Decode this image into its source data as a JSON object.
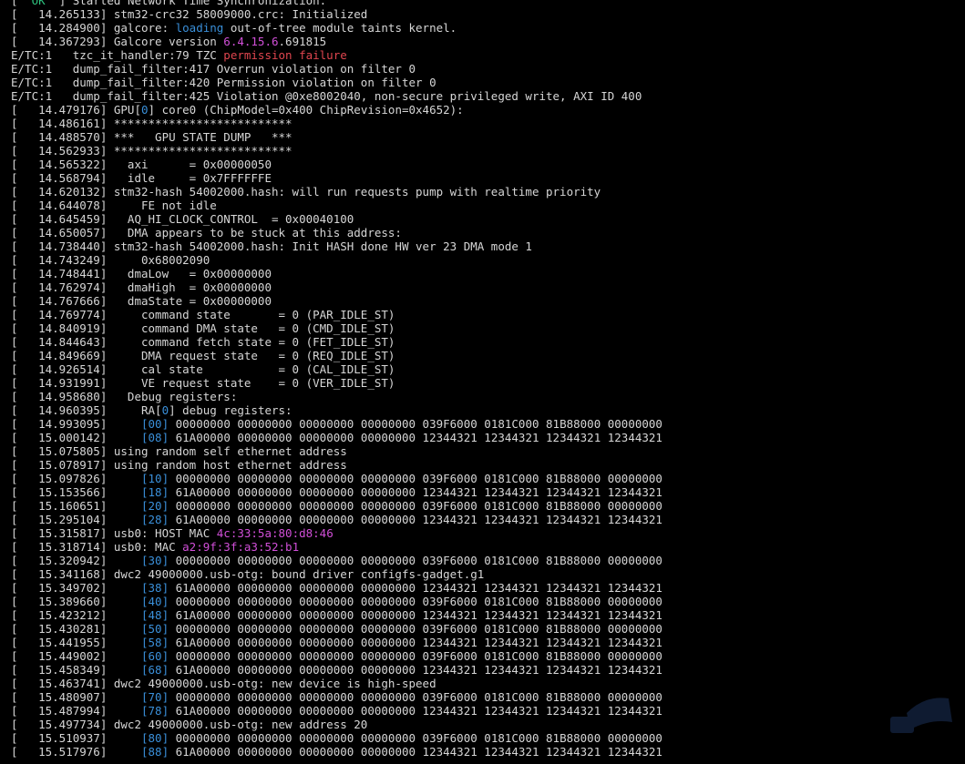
{
  "colors": {
    "background": "#000000",
    "text": "#d6d6d6",
    "ok": "#2ec27e",
    "highlight_blue": "#3a8fd9",
    "highlight_magenta": "#d14fd8",
    "highlight_red": "#e0464f"
  },
  "lines": [
    [
      {
        "t": "[  "
      },
      {
        "t": "OK",
        "c": "ok"
      },
      {
        "t": "  ] Started Network Time Synchronization."
      }
    ],
    [
      {
        "t": "[   14.265133] stm32-crc32 58009000.crc: Initialized"
      }
    ],
    [
      {
        "t": "[   14.284900] galcore: "
      },
      {
        "t": "loading",
        "c": "blue"
      },
      {
        "t": " out-of-tree module taints kernel."
      }
    ],
    [
      {
        "t": "[   14.367293] Galcore version "
      },
      {
        "t": "6.4.15.6",
        "c": "mag"
      },
      {
        "t": ".691815"
      }
    ],
    [
      {
        "t": "E/TC:1   tzc_it_handler:79 TZC "
      },
      {
        "t": "permission failure",
        "c": "red"
      }
    ],
    [
      {
        "t": "E/TC:1   dump_fail_filter:417 Overrun violation on filter 0"
      }
    ],
    [
      {
        "t": "E/TC:1   dump_fail_filter:420 Permission violation on filter 0"
      }
    ],
    [
      {
        "t": "E/TC:1   dump_fail_filter:425 Violation @0xe8002040, non-secure privileged write, AXI ID 400"
      }
    ],
    [
      {
        "t": "[   14.479176] GPU["
      },
      {
        "t": "0",
        "c": "blue"
      },
      {
        "t": "] core0 (ChipModel=0x400 ChipRevision=0x4652):"
      }
    ],
    [
      {
        "t": "[   14.486161] **************************"
      }
    ],
    [
      {
        "t": "[   14.488570] ***   GPU STATE DUMP   ***"
      }
    ],
    [
      {
        "t": "[   14.562933] **************************"
      }
    ],
    [
      {
        "t": "[   14.565322]   axi      = 0x00000050"
      }
    ],
    [
      {
        "t": "[   14.568794]   idle     = 0x7FFFFFFE"
      }
    ],
    [
      {
        "t": "[   14.620132] stm32-hash 54002000.hash: will run requests pump with realtime priority"
      }
    ],
    [
      {
        "t": "[   14.644078]     FE not idle"
      }
    ],
    [
      {
        "t": "[   14.645459]   AQ_HI_CLOCK_CONTROL  = 0x00040100"
      }
    ],
    [
      {
        "t": "[   14.650057]   DMA appears to be stuck at this address:"
      }
    ],
    [
      {
        "t": "[   14.738440] stm32-hash 54002000.hash: Init HASH done HW ver 23 DMA mode 1"
      }
    ],
    [
      {
        "t": "[   14.743249]     0x68002090"
      }
    ],
    [
      {
        "t": "[   14.748441]   dmaLow   = 0x00000000"
      }
    ],
    [
      {
        "t": "[   14.762974]   dmaHigh  = 0x00000000"
      }
    ],
    [
      {
        "t": "[   14.767666]   dmaState = 0x00000000"
      }
    ],
    [
      {
        "t": "[   14.769774]     command state       = 0 (PAR_IDLE_ST)"
      }
    ],
    [
      {
        "t": "[   14.840919]     command DMA state   = 0 (CMD_IDLE_ST)"
      }
    ],
    [
      {
        "t": "[   14.844643]     command fetch state = 0 (FET_IDLE_ST)"
      }
    ],
    [
      {
        "t": "[   14.849669]     DMA request state   = 0 (REQ_IDLE_ST)"
      }
    ],
    [
      {
        "t": "[   14.926514]     cal state           = 0 (CAL_IDLE_ST)"
      }
    ],
    [
      {
        "t": "[   14.931991]     VE request state    = 0 (VER_IDLE_ST)"
      }
    ],
    [
      {
        "t": "[   14.958680]   Debug registers:"
      }
    ],
    [
      {
        "t": "[   14.960395]     RA["
      },
      {
        "t": "0",
        "c": "blue"
      },
      {
        "t": "] debug registers:"
      }
    ],
    [
      {
        "t": "[   14.993095]     "
      },
      {
        "t": "[00]",
        "c": "blue"
      },
      {
        "t": " 00000000 00000000 00000000 00000000 039F6000 0181C000 81B88000 00000000"
      }
    ],
    [
      {
        "t": "[   15.000142]     "
      },
      {
        "t": "[08]",
        "c": "blue"
      },
      {
        "t": " 61A00000 00000000 00000000 00000000 12344321 12344321 12344321 12344321"
      }
    ],
    [
      {
        "t": "[   15.075805] using random self ethernet address"
      }
    ],
    [
      {
        "t": "[   15.078917] using random host ethernet address"
      }
    ],
    [
      {
        "t": "[   15.097826]     "
      },
      {
        "t": "[10]",
        "c": "blue"
      },
      {
        "t": " 00000000 00000000 00000000 00000000 039F6000 0181C000 81B88000 00000000"
      }
    ],
    [
      {
        "t": "[   15.153566]     "
      },
      {
        "t": "[18]",
        "c": "blue"
      },
      {
        "t": " 61A00000 00000000 00000000 00000000 12344321 12344321 12344321 12344321"
      }
    ],
    [
      {
        "t": "[   15.160651]     "
      },
      {
        "t": "[20]",
        "c": "blue"
      },
      {
        "t": " 00000000 00000000 00000000 00000000 039F6000 0181C000 81B88000 00000000"
      }
    ],
    [
      {
        "t": "[   15.295104]     "
      },
      {
        "t": "[28]",
        "c": "blue"
      },
      {
        "t": " 61A00000 00000000 00000000 00000000 12344321 12344321 12344321 12344321"
      }
    ],
    [
      {
        "t": "[   15.315817] usb0: HOST MAC "
      },
      {
        "t": "4c:33:5a:80:d8:46",
        "c": "mag"
      }
    ],
    [
      {
        "t": "[   15.318714] usb0: MAC "
      },
      {
        "t": "a2:9f:3f:a3:52:b1",
        "c": "mag"
      }
    ],
    [
      {
        "t": "[   15.320942]     "
      },
      {
        "t": "[30]",
        "c": "blue"
      },
      {
        "t": " 00000000 00000000 00000000 00000000 039F6000 0181C000 81B88000 00000000"
      }
    ],
    [
      {
        "t": "[   15.341168] dwc2 49000000.usb-otg: bound driver configfs-gadget.g1"
      }
    ],
    [
      {
        "t": "[   15.349702]     "
      },
      {
        "t": "[38]",
        "c": "blue"
      },
      {
        "t": " 61A00000 00000000 00000000 00000000 12344321 12344321 12344321 12344321"
      }
    ],
    [
      {
        "t": "[   15.389660]     "
      },
      {
        "t": "[40]",
        "c": "blue"
      },
      {
        "t": " 00000000 00000000 00000000 00000000 039F6000 0181C000 81B88000 00000000"
      }
    ],
    [
      {
        "t": "[   15.423212]     "
      },
      {
        "t": "[48]",
        "c": "blue"
      },
      {
        "t": " 61A00000 00000000 00000000 00000000 12344321 12344321 12344321 12344321"
      }
    ],
    [
      {
        "t": "[   15.430281]     "
      },
      {
        "t": "[50]",
        "c": "blue"
      },
      {
        "t": " 00000000 00000000 00000000 00000000 039F6000 0181C000 81B88000 00000000"
      }
    ],
    [
      {
        "t": "[   15.441955]     "
      },
      {
        "t": "[58]",
        "c": "blue"
      },
      {
        "t": " 61A00000 00000000 00000000 00000000 12344321 12344321 12344321 12344321"
      }
    ],
    [
      {
        "t": "[   15.449002]     "
      },
      {
        "t": "[60]",
        "c": "blue"
      },
      {
        "t": " 00000000 00000000 00000000 00000000 039F6000 0181C000 81B88000 00000000"
      }
    ],
    [
      {
        "t": "[   15.458349]     "
      },
      {
        "t": "[68]",
        "c": "blue"
      },
      {
        "t": " 61A00000 00000000 00000000 00000000 12344321 12344321 12344321 12344321"
      }
    ],
    [
      {
        "t": "[   15.463741] dwc2 49000000.usb-otg: new device is high-speed"
      }
    ],
    [
      {
        "t": "[   15.480907]     "
      },
      {
        "t": "[70]",
        "c": "blue"
      },
      {
        "t": " 00000000 00000000 00000000 00000000 039F6000 0181C000 81B88000 00000000"
      }
    ],
    [
      {
        "t": "[   15.487994]     "
      },
      {
        "t": "[78]",
        "c": "blue"
      },
      {
        "t": " 61A00000 00000000 00000000 00000000 12344321 12344321 12344321 12344321"
      }
    ],
    [
      {
        "t": "[   15.497734] dwc2 49000000.usb-otg: new address 20"
      }
    ],
    [
      {
        "t": "[   15.510937]     "
      },
      {
        "t": "[80]",
        "c": "blue"
      },
      {
        "t": " 00000000 00000000 00000000 00000000 039F6000 0181C000 81B88000 00000000"
      }
    ],
    [
      {
        "t": "[   15.517976]     "
      },
      {
        "t": "[88]",
        "c": "blue"
      },
      {
        "t": " 61A00000 00000000 00000000 00000000 12344321 12344321 12344321 12344321"
      }
    ]
  ]
}
